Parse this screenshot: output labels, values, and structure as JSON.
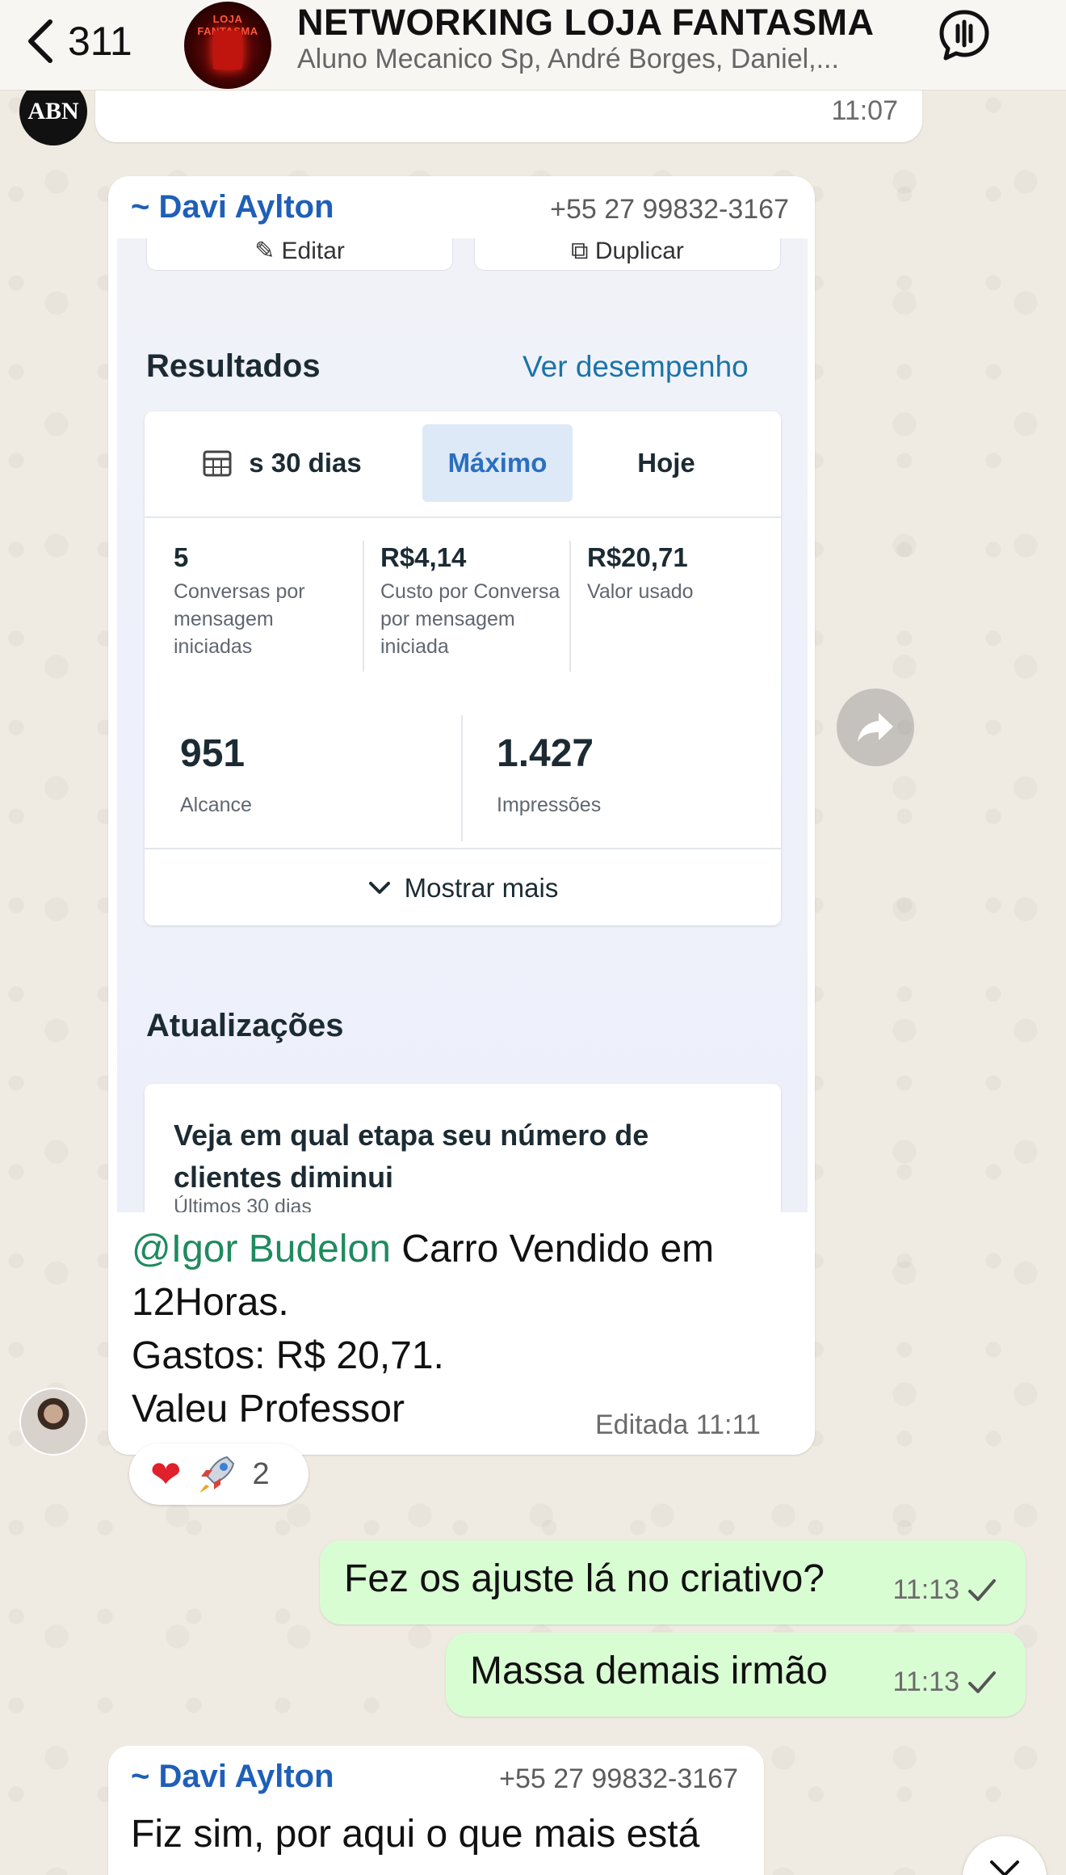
{
  "header": {
    "back_count": "311",
    "group_title": "NETWORKING LOJA FANTASMA",
    "group_members": "Aluno Mecanico Sp, André Borges, Daniel,...",
    "avatar_text": "LOJA FANTASMA"
  },
  "messages": {
    "first": {
      "avatar_text": "ABN",
      "time": "11:07"
    },
    "second": {
      "sender": "~ Davi Aylton",
      "phone": "+55 27 99832-3167",
      "screenshot": {
        "edit_label": "Editar",
        "duplicate_label": "Duplicar",
        "results_title": "Resultados",
        "performance_link": "Ver desempenho",
        "tabs": [
          "s 30 dias",
          "Máximo",
          "Hoje"
        ],
        "metrics": [
          {
            "value": "5",
            "label": "Conversas por mensagem iniciadas"
          },
          {
            "value": "R$4,14",
            "label": "Custo por Conversa por mensagem iniciada"
          },
          {
            "value": "R$20,71",
            "label": "Valor usado"
          }
        ],
        "reach": {
          "value": "951",
          "label": "Alcance"
        },
        "impressions": {
          "value": "1.427",
          "label": "Impressões"
        },
        "show_more": "Mostrar mais",
        "updates_title": "Atualizações",
        "update_card_title": "Veja em qual etapa seu número de clientes diminui",
        "update_card_sub": "Últimos 30 dias"
      },
      "mention": "@Igor Budelon",
      "text_after_mention": " Carro Vendido em",
      "line2": "12Horas.",
      "line3": "Gastos: R$ 20,71.",
      "line4": "Valeu Professor",
      "time": "Editada 11:11",
      "reactions": {
        "count": "2"
      }
    },
    "outgoing1": {
      "text": "Fez os ajuste lá no criativo?",
      "time": "11:13"
    },
    "outgoing2": {
      "text": "Massa demais irmão",
      "time": "11:13"
    },
    "third": {
      "sender": "~ Davi Aylton",
      "phone": "+55 27 99832-3167",
      "text": "Fiz sim, por aqui o que mais está"
    }
  },
  "colors": {
    "sender": "#1f5fb8",
    "mention": "#1f8a5e",
    "outgoing_bubble": "#d9fdd3",
    "link": "#1b74a8"
  }
}
